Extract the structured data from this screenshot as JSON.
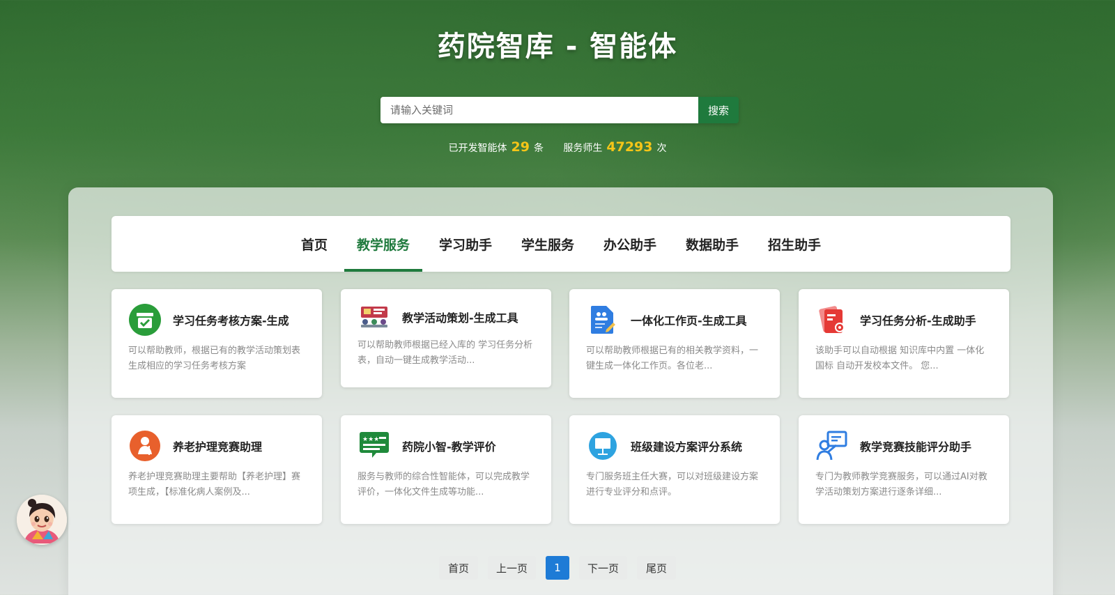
{
  "header": {
    "title": "药院智库 - 智能体"
  },
  "search": {
    "placeholder": "请输入关键词",
    "button_label": "搜索"
  },
  "stats": {
    "developed_prefix": "已开发智能体",
    "developed_count": "29",
    "developed_suffix": "条",
    "served_prefix": "服务师生",
    "served_count": "47293",
    "served_suffix": "次"
  },
  "nav": {
    "tabs": [
      {
        "label": "首页"
      },
      {
        "label": "教学服务"
      },
      {
        "label": "学习助手"
      },
      {
        "label": "学生服务"
      },
      {
        "label": "办公助手"
      },
      {
        "label": "数据助手"
      },
      {
        "label": "招生助手"
      }
    ],
    "active_index": 1
  },
  "cards": [
    {
      "title": "学习任务考核方案-生成",
      "desc": "可以帮助教师，根据已有的教学活动策划表生成相应的学习任务考核方案",
      "icon": "green-checklist-icon"
    },
    {
      "title": "教学活动策划-生成工具",
      "desc": "可以帮助教师根据已经入库的 学习任务分析表，自动一键生成教学活动...",
      "icon": "classroom-icon"
    },
    {
      "title": "一体化工作页-生成工具",
      "desc": "可以帮助教师根据已有的相关教学资料，一键生成一体化工作页。各位老...",
      "icon": "document-edit-icon"
    },
    {
      "title": "学习任务分析-生成助手",
      "desc": "该助手可以自动根据 知识库中内置 一体化国标 自动开发校本文件。 您...",
      "icon": "red-document-icon"
    },
    {
      "title": "养老护理竞赛助理",
      "desc": "养老护理竞赛助理主要帮助【养老护理】赛项生成，【标准化病人案例及...",
      "icon": "elder-care-icon"
    },
    {
      "title": "药院小智-教学评价",
      "desc": "服务与教师的综合性智能体，可以完成教学评价，一体化文件生成等功能...",
      "icon": "rating-chat-icon"
    },
    {
      "title": "班级建设方案评分系统",
      "desc": "专门服务班主任大赛，可以对班级建设方案进行专业评分和点评。",
      "icon": "presentation-board-icon"
    },
    {
      "title": "教学竞赛技能评分助手",
      "desc": "专门为教师教学竞赛服务，可以通过AI对教学活动策划方案进行逐条详细...",
      "icon": "teacher-board-icon"
    }
  ],
  "pagination": {
    "first": "首页",
    "prev": "上一页",
    "current": "1",
    "next": "下一页",
    "last": "尾页"
  },
  "colors": {
    "brand_green": "#1f7a3d",
    "stat_yellow": "#f5c518",
    "page_blue": "#1e7bd6"
  }
}
